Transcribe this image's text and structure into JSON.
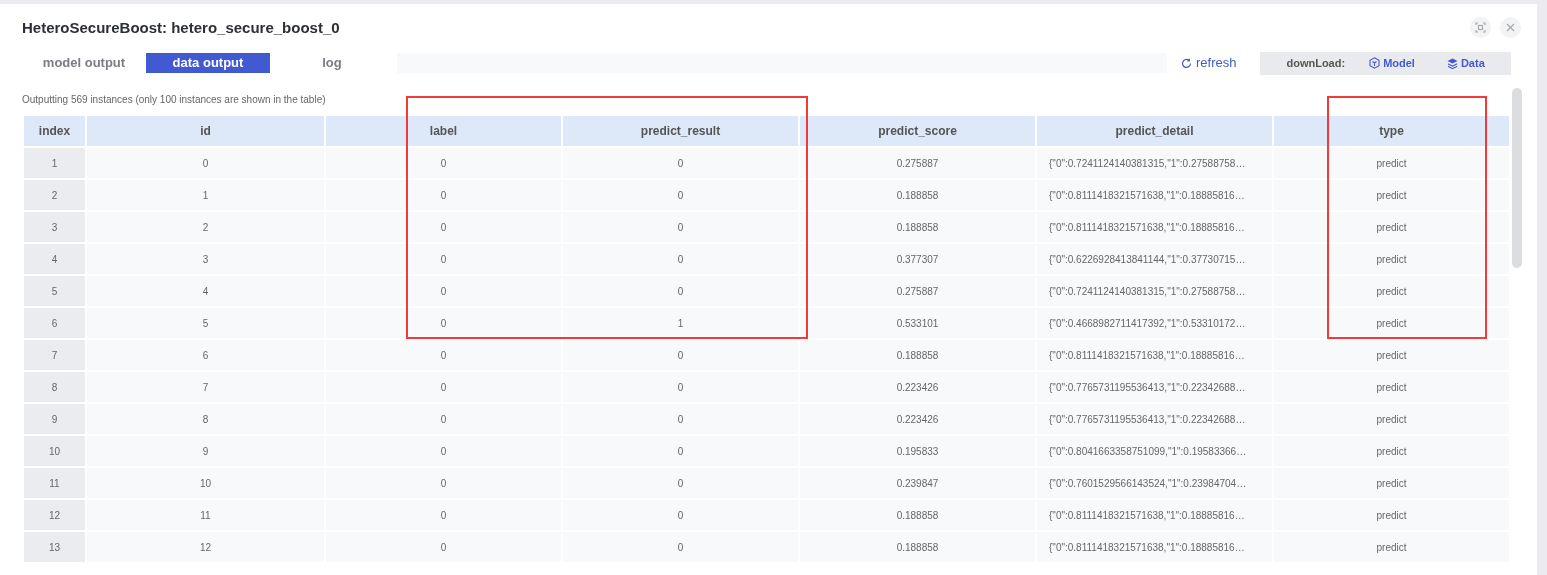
{
  "window": {
    "title": "HeteroSecureBoost: hetero_secure_boost_0"
  },
  "tabs": [
    {
      "label": "model output",
      "selected": false
    },
    {
      "label": "data output",
      "selected": true
    },
    {
      "label": "log",
      "selected": false
    }
  ],
  "refresh": {
    "label": "refresh"
  },
  "download": {
    "label": "downLoad:",
    "buttons": [
      {
        "kind": "model",
        "label": "Model"
      },
      {
        "kind": "data",
        "label": "Data"
      }
    ]
  },
  "summary": "Outputting 569 instances (only 100 instances are shown in the table)",
  "annotations": [
    {
      "kind": "highlight_box"
    },
    {
      "kind": "highlight_box"
    }
  ],
  "table": {
    "columns": [
      {
        "label": "index"
      },
      {
        "label": "id"
      },
      {
        "label": "label"
      },
      {
        "label": "predict_result"
      },
      {
        "label": "predict_score"
      },
      {
        "label": "predict_detail"
      },
      {
        "label": "type"
      }
    ],
    "rows": [
      {
        "cells": [
          "1",
          "0",
          "0",
          "0",
          "0.275887",
          "{\"0\":0.7241124140381315,\"1\":0.27588758…",
          "predict"
        ]
      },
      {
        "cells": [
          "2",
          "1",
          "0",
          "0",
          "0.188858",
          "{\"0\":0.8111418321571638,\"1\":0.18885816…",
          "predict"
        ]
      },
      {
        "cells": [
          "3",
          "2",
          "0",
          "0",
          "0.188858",
          "{\"0\":0.8111418321571638,\"1\":0.18885816…",
          "predict"
        ]
      },
      {
        "cells": [
          "4",
          "3",
          "0",
          "0",
          "0.377307",
          "{\"0\":0.6226928413841144,\"1\":0.37730715…",
          "predict"
        ]
      },
      {
        "cells": [
          "5",
          "4",
          "0",
          "0",
          "0.275887",
          "{\"0\":0.7241124140381315,\"1\":0.27588758…",
          "predict"
        ]
      },
      {
        "cells": [
          "6",
          "5",
          "0",
          "1",
          "0.533101",
          "{\"0\":0.4668982711417392,\"1\":0.53310172…",
          "predict"
        ]
      },
      {
        "cells": [
          "7",
          "6",
          "0",
          "0",
          "0.188858",
          "{\"0\":0.8111418321571638,\"1\":0.18885816…",
          "predict"
        ]
      },
      {
        "cells": [
          "8",
          "7",
          "0",
          "0",
          "0.223426",
          "{\"0\":0.7765731195536413,\"1\":0.22342688…",
          "predict"
        ]
      },
      {
        "cells": [
          "9",
          "8",
          "0",
          "0",
          "0.223426",
          "{\"0\":0.7765731195536413,\"1\":0.22342688…",
          "predict"
        ]
      },
      {
        "cells": [
          "10",
          "9",
          "0",
          "0",
          "0.195833",
          "{\"0\":0.8041663358751099,\"1\":0.19583366…",
          "predict"
        ]
      },
      {
        "cells": [
          "11",
          "10",
          "0",
          "0",
          "0.239847",
          "{\"0\":0.7601529566143524,\"1\":0.23984704…",
          "predict"
        ]
      },
      {
        "cells": [
          "12",
          "11",
          "0",
          "0",
          "0.188858",
          "{\"0\":0.8111418321571638,\"1\":0.18885816…",
          "predict"
        ]
      },
      {
        "cells": [
          "13",
          "12",
          "0",
          "0",
          "0.188858",
          "{\"0\":0.8111418321571638,\"1\":0.18885816…",
          "predict"
        ]
      }
    ]
  }
}
